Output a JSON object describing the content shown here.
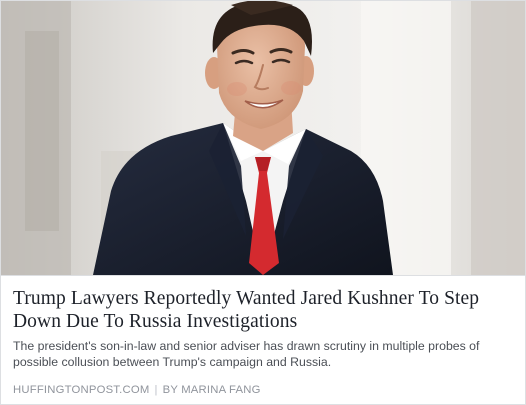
{
  "article": {
    "image_alt": "photo",
    "headline": "Trump Lawyers Reportedly Wanted Jared Kushner To Step Down Due To Russia Investigations",
    "description": "The president's son-in-law and senior adviser has drawn scrutiny in multiple probes of possible collusion between Trump's campaign and Russia.",
    "source": "HUFFINGTONPOST.COM",
    "separator": "|",
    "byline": "BY MARINA FANG"
  },
  "colors": {
    "headline": "#1d2129",
    "description": "#4b4f56",
    "meta": "#90949c",
    "border": "#dddfe2",
    "suit": "#1a2030",
    "tie": "#d42a2f",
    "shirt": "#f4f4f4"
  }
}
